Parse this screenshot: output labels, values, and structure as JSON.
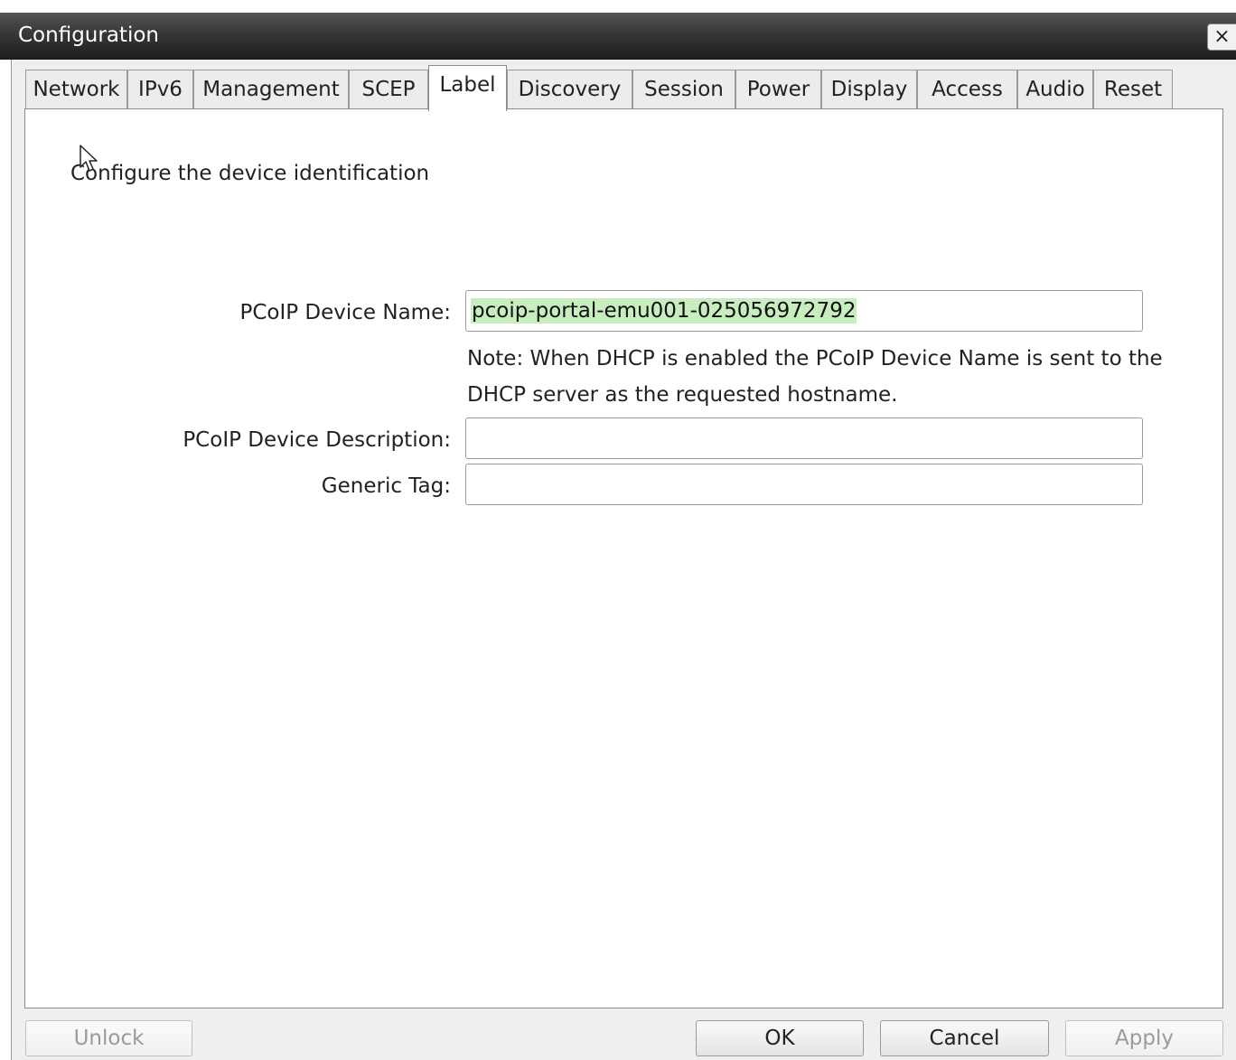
{
  "window": {
    "title": "Configuration",
    "close_label": "×"
  },
  "tabs": [
    {
      "label": "Network"
    },
    {
      "label": "IPv6"
    },
    {
      "label": "Management"
    },
    {
      "label": "SCEP"
    },
    {
      "label": "Label",
      "active": true
    },
    {
      "label": "Discovery"
    },
    {
      "label": "Session"
    },
    {
      "label": "Power"
    },
    {
      "label": "Display"
    },
    {
      "label": "Access"
    },
    {
      "label": "Audio"
    },
    {
      "label": "Reset"
    }
  ],
  "label_panel": {
    "intro": "Configure the device identification",
    "device_name": {
      "label": "PCoIP Device Name:",
      "value": "pcoip-portal-emu001-025056972792"
    },
    "note": "Note: When DHCP is enabled the PCoIP Device Name is sent to the DHCP server as the requested hostname.",
    "device_description": {
      "label": "PCoIP Device Description:",
      "value": ""
    },
    "generic_tag": {
      "label": "Generic Tag:",
      "value": ""
    }
  },
  "buttons": {
    "unlock": "Unlock",
    "ok": "OK",
    "cancel": "Cancel",
    "apply": "Apply"
  },
  "icons": {
    "cursor": "mouse-pointer-icon"
  }
}
